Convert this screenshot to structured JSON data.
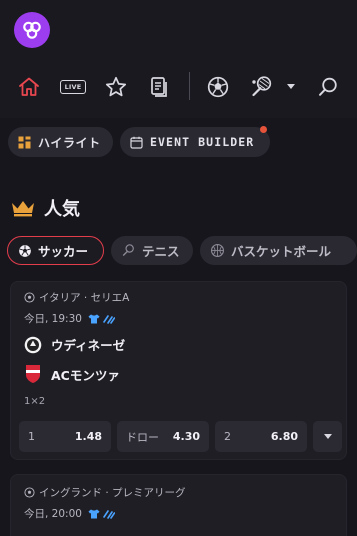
{
  "brand": {
    "logo_icon": "brand-infinity-logo",
    "accent": "#9d3df0"
  },
  "nav": {
    "items": [
      {
        "name": "home-icon",
        "color": "#e8474f"
      },
      {
        "name": "live-icon",
        "label": "LIVE"
      },
      {
        "name": "star-icon"
      },
      {
        "name": "betslip-icon"
      },
      {
        "name": "football-icon"
      },
      {
        "name": "tennis-icon"
      },
      {
        "name": "search-icon"
      }
    ]
  },
  "chips": [
    {
      "label": "ハイライト",
      "icon": "highlight-icon"
    },
    {
      "label": "EVENT BUILDER",
      "icon": "calendar-icon",
      "badge_color": "#e5533b"
    }
  ],
  "popular": {
    "title": "人気",
    "icon": "crown-icon",
    "icon_color": "#e9a23b"
  },
  "sport_tabs": [
    {
      "label": "サッカー",
      "icon": "football-icon",
      "active": true
    },
    {
      "label": "テニス",
      "icon": "tennis-icon",
      "active": false
    },
    {
      "label": "バスケットボール",
      "icon": "basketball-icon",
      "active": false
    }
  ],
  "matches": [
    {
      "league": "イタリア · セリエA",
      "time": "今日, 19:30",
      "teams": [
        {
          "name": "ウディネーゼ",
          "crest": "udinese-crest-icon"
        },
        {
          "name": "ACモンツァ",
          "crest": "monza-crest-icon"
        }
      ],
      "market": "1×2",
      "odds": [
        {
          "sel": "1",
          "price": "1.48"
        },
        {
          "sel": "ドロー",
          "price": "4.30"
        },
        {
          "sel": "2",
          "price": "6.80"
        }
      ]
    },
    {
      "league": "イングランド · プレミアリーグ",
      "time": "今日, 20:00"
    }
  ]
}
